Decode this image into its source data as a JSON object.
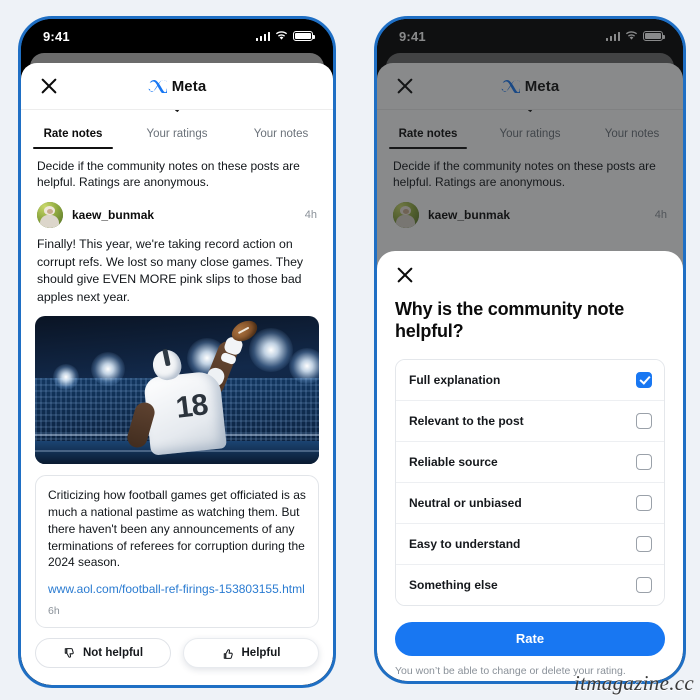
{
  "theme": {
    "brand_blue": "#1877f2",
    "frame_blue": "#1f6fc4",
    "link_blue": "#2a7bd1",
    "page_bg": "#eef2f7"
  },
  "status_bar": {
    "time": "9:41",
    "signal_icon": "cellular-signal-icon",
    "wifi_icon": "wifi-icon",
    "battery_icon": "battery-icon"
  },
  "app_header": {
    "close_icon": "close-icon",
    "logo_icon": "meta-infinity-logo-icon",
    "brand": "Meta"
  },
  "tabs": [
    {
      "label": "Rate notes",
      "active": true
    },
    {
      "label": "Your ratings",
      "active": false
    },
    {
      "label": "Your notes",
      "active": false
    }
  ],
  "feed": {
    "lede": "Decide if the community notes on these posts are helpful. Ratings are anonymous.",
    "post": {
      "avatar_icon": "user-avatar",
      "username": "kaew_bunmak",
      "timestamp": "4h",
      "body": "Finally! This year, we're taking record action on corrupt refs. We lost so many close games. They should give EVEN MORE pink slips to those bad apples next year.",
      "image_alt": "american-football-player-throwing-ball-stadium-photo"
    },
    "note": {
      "body": "Criticizing how football games get officiated is as much a national pastime as watching them. But there haven't been any announcements of any terminations of referees for corruption during the 2024 season.",
      "link": "www.aol.com/football-ref-firings-153803155.html",
      "timestamp": "6h",
      "actions": [
        {
          "label": "Not helpful",
          "icon": "thumbs-down-icon",
          "raised": false
        },
        {
          "label": "Helpful",
          "icon": "thumbs-up-icon",
          "raised": true
        }
      ]
    }
  },
  "modal": {
    "close_icon": "close-icon",
    "title": "Why is the community note helpful?",
    "options": [
      {
        "label": "Full explanation",
        "checked": true
      },
      {
        "label": "Relevant to the post",
        "checked": false
      },
      {
        "label": "Reliable source",
        "checked": false
      },
      {
        "label": "Neutral or unbiased",
        "checked": false
      },
      {
        "label": "Easy to understand",
        "checked": false
      },
      {
        "label": "Something else",
        "checked": false
      }
    ],
    "submit_label": "Rate",
    "disclaimer": "You won’t be able to change or delete your rating."
  },
  "watermark": "itmagazine.cc"
}
